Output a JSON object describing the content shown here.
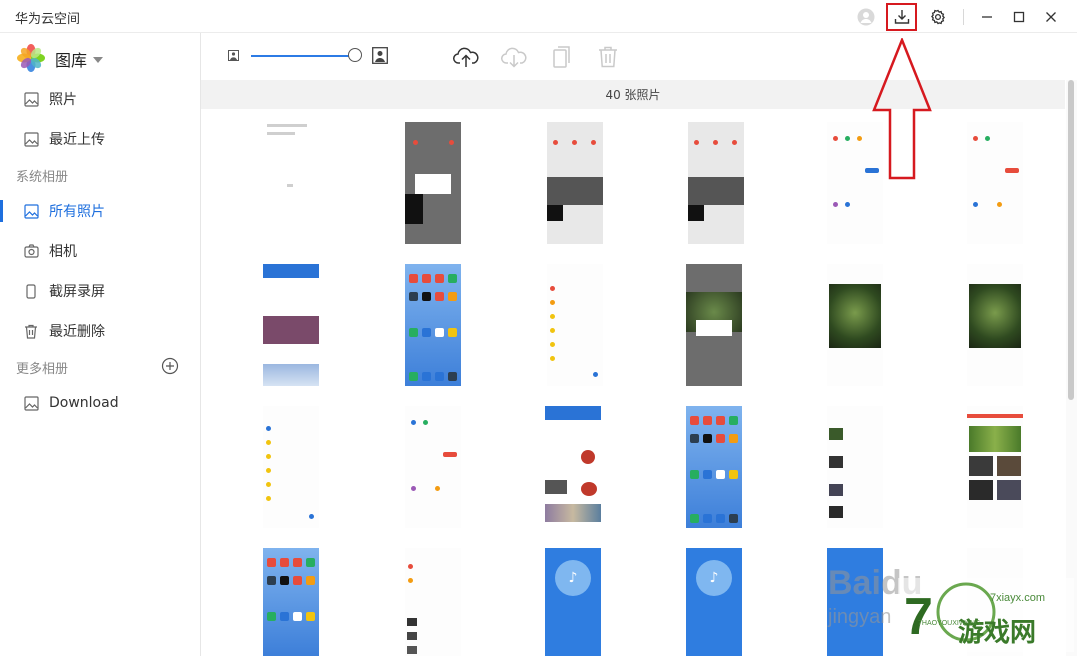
{
  "window": {
    "title": "华为云空间",
    "buttons": [
      "avatar",
      "download",
      "settings",
      "minimize",
      "maximize",
      "close"
    ]
  },
  "sidebar": {
    "library_title": "图库",
    "top_items": [
      {
        "label": "照片",
        "icon": "photo-icon"
      },
      {
        "label": "最近上传",
        "icon": "photo-icon"
      }
    ],
    "system_section": "系统相册",
    "system_items": [
      {
        "label": "所有照片",
        "icon": "photo-icon",
        "active": true
      },
      {
        "label": "相机",
        "icon": "camera-icon"
      },
      {
        "label": "截屏录屏",
        "icon": "phone-icon"
      },
      {
        "label": "最近删除",
        "icon": "trash-icon"
      }
    ],
    "more_section": "更多相册",
    "more_items": [
      {
        "label": "Download",
        "icon": "photo-icon"
      }
    ]
  },
  "toolbar": {
    "zoom_level": 1.0,
    "actions": [
      "upload",
      "cloud-download",
      "copy",
      "delete"
    ]
  },
  "gallery": {
    "count_label": "40 张照片"
  },
  "colors": {
    "accent": "#1e6fde",
    "annotation": "#d6191f"
  },
  "watermarks": {
    "baidu": "Baidu",
    "jingyan": "jingyan",
    "game_text": "游戏网",
    "game_url": "7xiayx.com",
    "game_pinyin": "7HAOYOUXIWANG"
  }
}
